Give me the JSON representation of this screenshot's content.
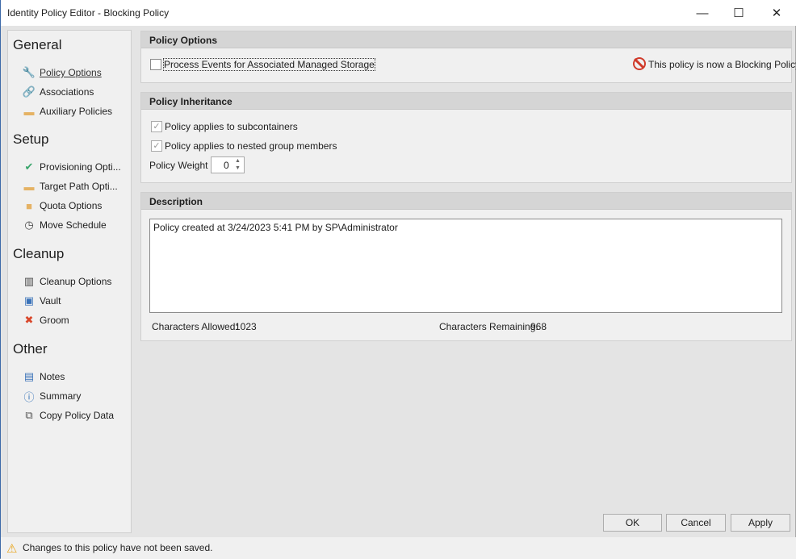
{
  "window": {
    "title": "Identity Policy Editor - Blocking Policy",
    "minimize": "—",
    "maximize": "☐",
    "close": "✕"
  },
  "sidebar": {
    "groups": [
      {
        "label": "General",
        "items": [
          {
            "label": "Policy Options",
            "icon": "wrench-icon",
            "selected": true
          },
          {
            "label": "Associations",
            "icon": "link-icon"
          },
          {
            "label": "Auxiliary Policies",
            "icon": "folder-icon"
          }
        ]
      },
      {
        "label": "Setup",
        "items": [
          {
            "label": "Provisioning Opti...",
            "icon": "checkmark-icon"
          },
          {
            "label": "Target Path Opti...",
            "icon": "network-folder-icon"
          },
          {
            "label": "Quota Options",
            "icon": "database-icon"
          },
          {
            "label": "Move Schedule",
            "icon": "clock-icon"
          }
        ]
      },
      {
        "label": "Cleanup",
        "items": [
          {
            "label": "Cleanup Options",
            "icon": "trash-icon"
          },
          {
            "label": "Vault",
            "icon": "vault-icon"
          },
          {
            "label": "Groom",
            "icon": "x-icon"
          }
        ]
      },
      {
        "label": "Other",
        "items": [
          {
            "label": "Notes",
            "icon": "document-icon"
          },
          {
            "label": "Summary",
            "icon": "summary-info-icon"
          },
          {
            "label": "Copy Policy Data",
            "icon": "copy-icon"
          }
        ]
      }
    ]
  },
  "policy_options": {
    "header": "Policy Options",
    "process_events_label": "Process Events for Associated Managed Storage",
    "process_events_checked": false,
    "blocking_notice": "This policy is now a Blocking Policy."
  },
  "inheritance": {
    "header": "Policy Inheritance",
    "subcontainers_label": "Policy applies to subcontainers",
    "subcontainers_checked": true,
    "nested_label": "Policy applies to nested group members",
    "nested_checked": true,
    "weight_label": "Policy Weight",
    "weight_value": "0"
  },
  "description": {
    "header": "Description",
    "text": "Policy created at 3/24/2023 5:41 PM by SP\\Administrator",
    "allowed_label": "Characters Allowed:",
    "allowed_value": "1023",
    "remaining_label": "Characters Remaining:",
    "remaining_value": "968"
  },
  "buttons": {
    "ok": "OK",
    "cancel": "Cancel",
    "apply": "Apply"
  },
  "status": {
    "message": "Changes to this policy have not been saved."
  }
}
